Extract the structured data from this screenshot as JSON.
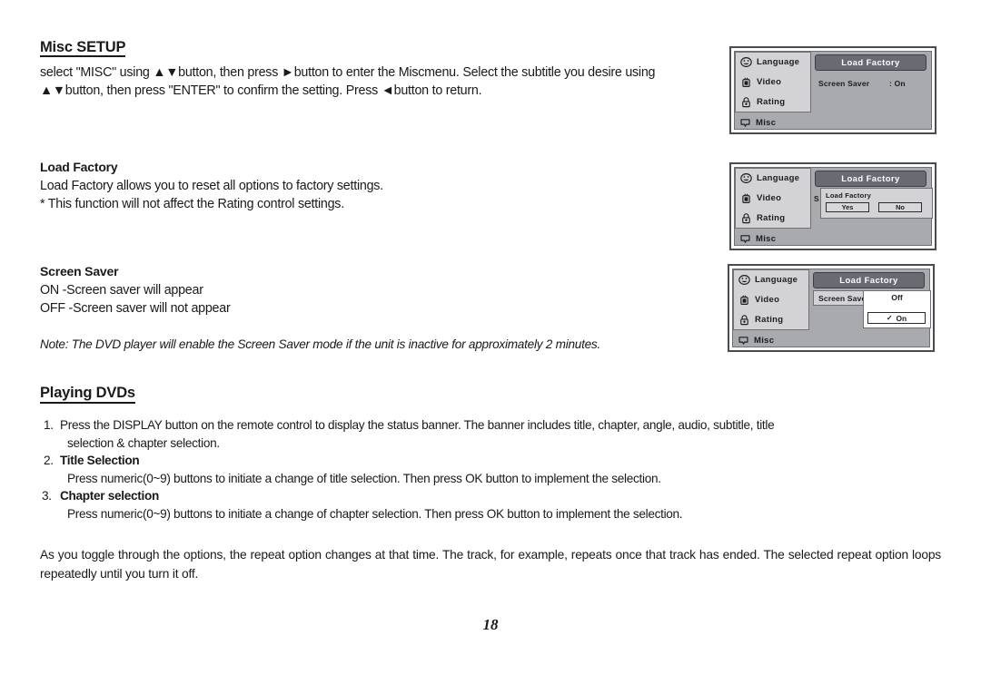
{
  "misc_setup": {
    "heading": "Misc SETUP",
    "paragraph": "select \"MISC\" using ▲▼button, then press ►button to enter the Miscmenu. Select the subtitle you desire using ▲▼button, then press \"ENTER\" to confirm the setting. Press ◄button to return."
  },
  "load_factory": {
    "heading": "Load Factory",
    "line1": "Load Factory allows you to reset all options to factory settings.",
    "line2": "* This function will not affect the Rating control settings."
  },
  "screen_saver": {
    "heading": "Screen Saver",
    "line1": "ON -Screen saver will appear",
    "line2": "OFF -Screen saver will not appear"
  },
  "note": "Note: The DVD player will enable the Screen Saver mode if the unit is inactive for approximately 2 minutes.",
  "playing_dvds": {
    "heading": "Playing DVDs",
    "items": [
      {
        "num": "1.",
        "body": "Press the DISPLAY button on the remote control to display the status banner. The banner includes title, chapter, angle, audio, subtitle, title",
        "cont": "selection & chapter selection.",
        "bold": false
      },
      {
        "num": "2.",
        "body": "Title Selection",
        "cont": "Press numeric(0~9) buttons to initiate a change of title selection. Then press OK button to implement the selection.",
        "bold": true
      },
      {
        "num": "3.",
        "body": "Chapter selection",
        "cont": "Press numeric(0~9) buttons to initiate a change of chapter selection. Then press OK  button to implement the selection.",
        "bold": true
      }
    ]
  },
  "closing": "As you toggle through the options, the repeat option changes at that time. The track, for example, repeats once that track has ended. The selected repeat option loops repeatedly until you turn it off.",
  "page_number": "18",
  "osd_common": {
    "sidebar": [
      {
        "label": "Language",
        "icon": "smiley-face-icon"
      },
      {
        "label": "Video",
        "icon": "television-icon"
      },
      {
        "label": "Rating",
        "icon": "padlock-icon"
      },
      {
        "label": "Misc",
        "icon": "speech-bubble-icon"
      }
    ],
    "header_title": "Load Factory"
  },
  "osd_1": {
    "row_label": "Screen Saver",
    "row_value": ": On"
  },
  "osd_2": {
    "dialog_title": "Load Factory",
    "yes_label": "Yes",
    "no_label": "No",
    "ghost_label": "S"
  },
  "osd_3": {
    "row_label": "Screen Saver",
    "current_value": "Off",
    "option_checked": "On",
    "check_glyph": "✓"
  },
  "colors": {
    "osd_body": "#a9aaae",
    "osd_sidebar_item": "#d3d3d6",
    "osd_header": "#6a6a72",
    "osd_border": "#4a4a52"
  }
}
